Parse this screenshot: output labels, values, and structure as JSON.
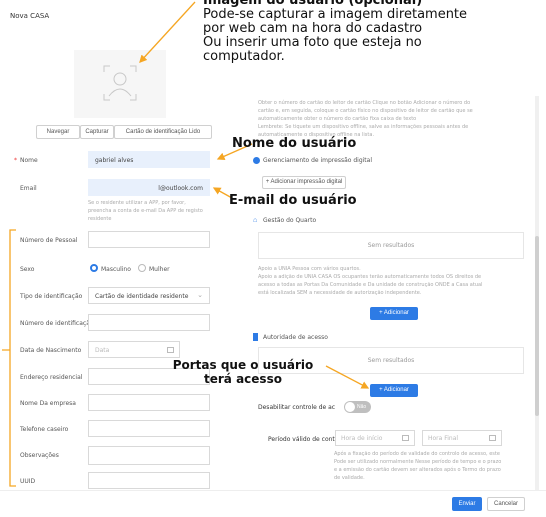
{
  "window": {
    "title": "Nova CASA"
  },
  "photo_annotation": {
    "title": "Imagem do usuário (opcional)",
    "lines": [
      "Pode-se capturar a imagem diretamente",
      "por web cam na hora do cadastro",
      "Ou inserir uma foto que esteja no",
      "computador."
    ]
  },
  "photo_buttons": {
    "browse": "Navegar",
    "capture": "Capturar",
    "id_card": "Cartão de identificação Lido"
  },
  "form": {
    "name_label": "Nome",
    "name_required": "*",
    "name_value": "gabriel alves",
    "email_label": "Email",
    "email_value": "l@outlook.com",
    "email_hint": "Se o residente utilizar a APP, por favor, preencha a conta de e-mail Da APP de registo residente",
    "personal_number_label": "Número de Pessoal",
    "sex_label": "Sexo",
    "sex_male": "Masculino",
    "sex_female": "Mulher",
    "id_type_label": "Tipo de identificação",
    "id_type_value": "Cartão de identidade residente",
    "id_number_label": "Número de identificação",
    "birth_label": "Data de Nascimento",
    "birth_placeholder": "Data",
    "address_label": "Endereço residencial",
    "company_label": "Nome Da empresa",
    "phone_label": "Telefone caseiro",
    "notes_label": "Observações",
    "uuid_label": "UUID"
  },
  "right": {
    "card_notes": [
      "Obter o número do cartão do leitor de cartão Clique no botão Adicionar o número do",
      "cartão e, em seguida, coloque o cartão físico no dispositivo de leitor de cartão que se",
      "automaticamente obter o número do cartão fixa caixa de texto",
      "Lembrete: Se tiquete um dispositivo offline, salve as informações pessoais antes de",
      "automaticamente o dispositivo offline na lista."
    ],
    "fingerprint_title": "Gerenciamento de impressão digital",
    "fingerprint_button": "+ Adicionar impressão digital",
    "room_title": "Gestão do Quarto",
    "no_results": "Sem resultados",
    "room_notes": [
      "Apoio a UNIA Pessoa com vários quartos.",
      "Apoio a adição de UNIA CASA OS ocupantes terão automaticamente todos OS direitos de",
      "acesso a todas as Portas Da Comunidade e Da unidade de construção ONDE a Casa atual",
      "está localizada SEM a necessidade de autorização independente."
    ],
    "add_button": "+ Adicionar",
    "access_title": "Autoridade de acesso",
    "no_results_2": "Sem resultados",
    "add_button_2": "+ Adicionar",
    "disable_access_label": "Desabilitar controle de ac",
    "toggle_label": "Não",
    "validity_label": "Período válido de cont",
    "start_placeholder": "Hora de início",
    "end_placeholder": "Hora Final",
    "validity_notes": [
      "Após a fixação do período de validade do controlo de acesso, este",
      "Pode ser utilizado normalmente Nesse período de tempo e o prazo",
      "e a emissão do cartão devem ser alterados após o Termo do prazo",
      "de validade."
    ]
  },
  "annotations": {
    "name": "Nome do usuário",
    "email": "E-mail do usuário",
    "doors_line1": "Portas que o usuário",
    "doors_line2": "terá acesso"
  },
  "footer": {
    "send": "Enviar",
    "cancel": "Cancelar"
  },
  "colors": {
    "accent": "#2d7be5",
    "arrow": "#f5a623",
    "name_fill": "#e8f0fc"
  }
}
